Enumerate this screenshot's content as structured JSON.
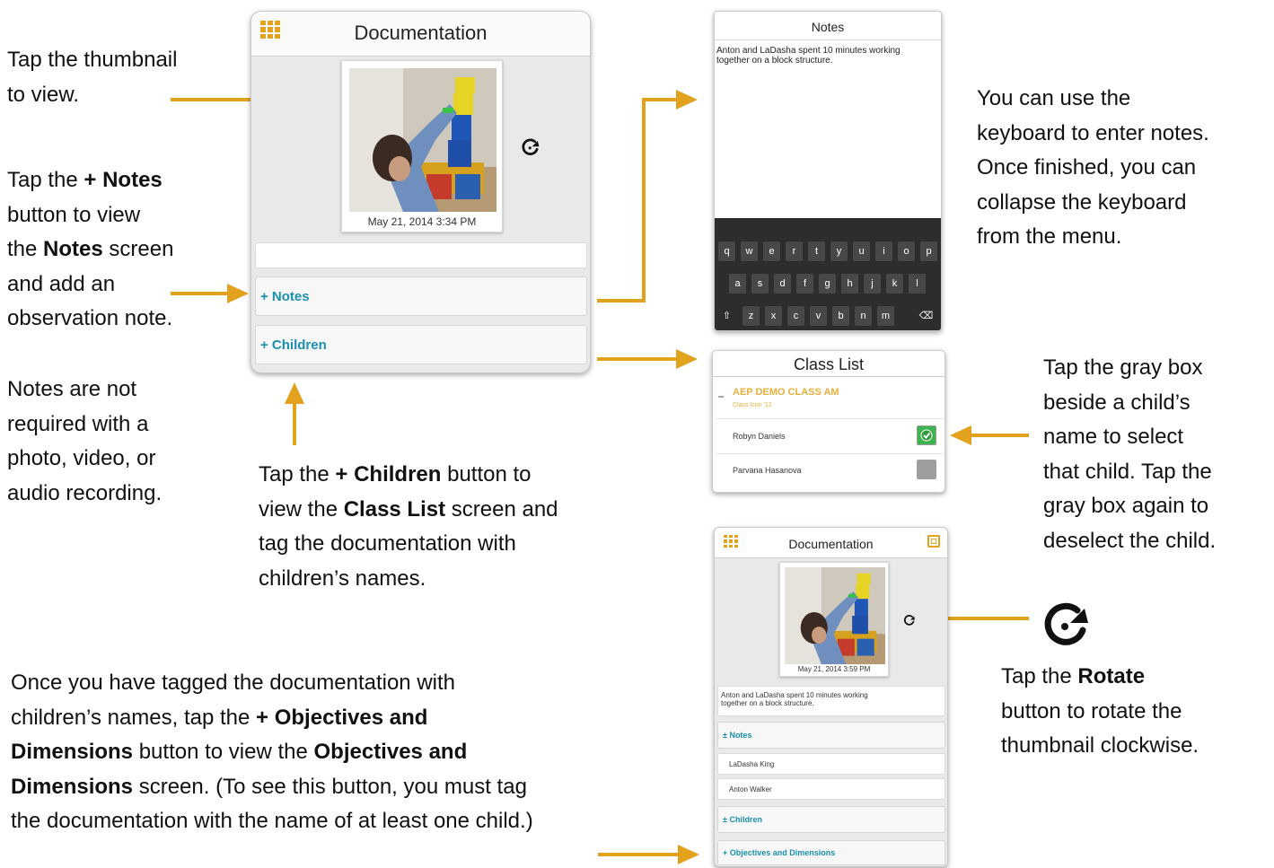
{
  "callouts": {
    "thumbnail": {
      "line1": "Tap the thumbnail",
      "line2": "to view."
    },
    "notes_button": {
      "l1a": "Tap the ",
      "l1b": "+ Notes",
      "l2": "button to view",
      "l3a": "the ",
      "l3b": "Notes",
      "l3c": " screen",
      "l4": "and add an",
      "l5": "observation note."
    },
    "not_required": {
      "line1": "Notes are not",
      "line2": "required with a",
      "line3": "photo, video, or",
      "line4": "audio recording."
    },
    "children_button": {
      "l1a": "Tap the ",
      "l1b": "+ Children",
      "l1c": " button to",
      "l2a": "view the ",
      "l2b": "Class List",
      "l2c": " screen and",
      "l3": "tag the documentation with",
      "l4": "children’s names."
    },
    "keyboard": {
      "line1": "You can use the",
      "line2": "keyboard to enter notes.",
      "line3": "Once finished, you can",
      "line4": "collapse the keyboard",
      "line5": "from the menu."
    },
    "graybox": {
      "line1": "Tap the gray box",
      "line2": "beside a child’s",
      "line3": "name to select",
      "line4": "that child. Tap the",
      "line5": "gray box again to",
      "line6": "deselect the child."
    },
    "rotate": {
      "l1a": "Tap the ",
      "l1b": "Rotate",
      "l2": "button to rotate the",
      "l3": "thumbnail clockwise."
    },
    "objectives": {
      "l1": "Once you have tagged the documentation with",
      "l2a": "children’s names, tap the ",
      "l2b": "+ Objectives and",
      "l3a": "Dimensions",
      "l3b": " button to view the ",
      "l3c": "Objectives and",
      "l4a": "Dimensions",
      "l4b": " screen. (To see this button, you must tag",
      "l5": "the documentation with the name of at least one child.)"
    }
  },
  "doc_screen": {
    "title": "Documentation",
    "date": "May  21, 2014 3:34 PM",
    "notes_button": "+ Notes",
    "children_button": "+ Children"
  },
  "notes_screen": {
    "title": "Notes",
    "note_text_1": "Anton and LaDasha spent 10 minutes working",
    "note_text_2": "together on a block structure.",
    "keyboard_rows": [
      [
        "q",
        "w",
        "e",
        "r",
        "t",
        "y",
        "u",
        "i",
        "o",
        "p"
      ],
      [
        "a",
        "s",
        "d",
        "f",
        "g",
        "h",
        "j",
        "k",
        "l"
      ],
      [
        "z",
        "x",
        "c",
        "v",
        "b",
        "n",
        "m"
      ]
    ],
    "shift_key": "⇧",
    "delete_key": "⌫"
  },
  "class_list": {
    "title": "Class List",
    "class_name": "AEP DEMO CLASS AM",
    "class_sub": "Class Icon '12",
    "children": [
      {
        "name": "Robyn Daniels",
        "selected": true
      },
      {
        "name": "Parvana Hasanova",
        "selected": false
      }
    ],
    "colors": {
      "selected": "#3fb34f",
      "unselected": "#9e9e9e",
      "accent": "#e7b03c"
    }
  },
  "doc_screen_2": {
    "title": "Documentation",
    "date": "May  21, 2014 3:59 PM",
    "note_1": "Anton and LaDasha spent 10 minutes working",
    "note_2": "together on a block structure.",
    "notes_button": "± Notes",
    "child_1": "LaDasha King",
    "child_2": "Anton Walker",
    "children_button": "± Children",
    "objectives_button": "+ Objectives and Dimensions"
  },
  "icons": {
    "grid": "grid-menu-icon",
    "rotate": "rotate-icon",
    "gallery": "gallery-icon"
  },
  "colors": {
    "arrow": "#e2a21e",
    "link": "#1a8fb0"
  }
}
